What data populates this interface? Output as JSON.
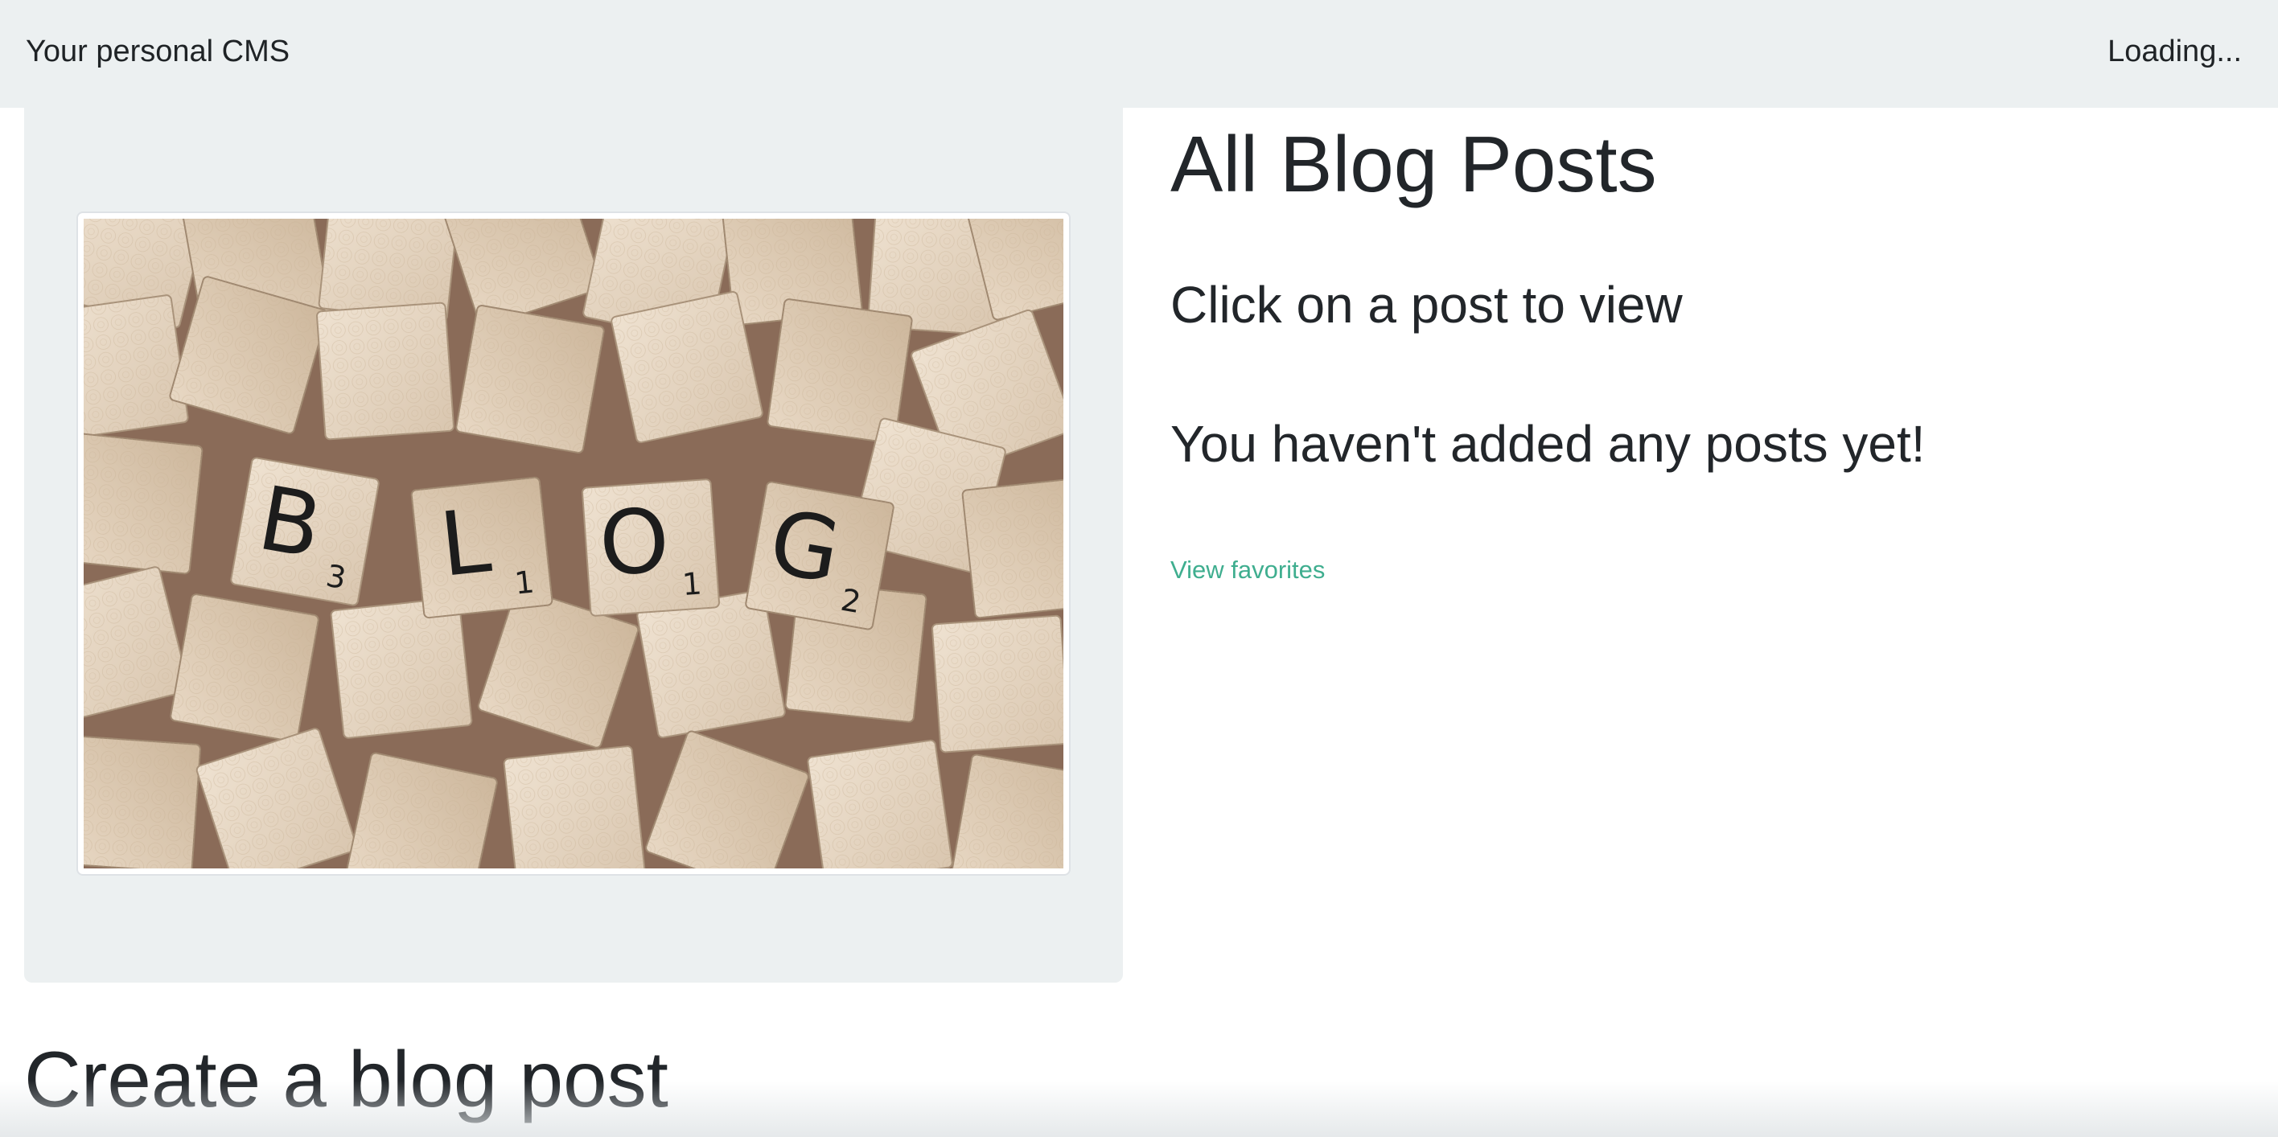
{
  "navbar": {
    "brand": "Your personal CMS",
    "status": "Loading..."
  },
  "hero": {
    "image_icon": "blog-scrabble-tiles-image",
    "tiles": [
      {
        "letter": "B",
        "score": "3"
      },
      {
        "letter": "L",
        "score": "1"
      },
      {
        "letter": "O",
        "score": "1"
      },
      {
        "letter": "G",
        "score": "2"
      }
    ]
  },
  "main": {
    "title": "All Blog Posts",
    "subtitle": "Click on a post to view",
    "empty_message": "You haven't added any posts yet!",
    "favorites_link": "View favorites"
  },
  "create": {
    "heading": "Create a blog post"
  },
  "colors": {
    "navbar_bg": "#ecf0f1",
    "jumbotron_bg": "#ecf0f1",
    "text": "#22262a",
    "link": "#3fae8f",
    "background": "#ffffff"
  }
}
